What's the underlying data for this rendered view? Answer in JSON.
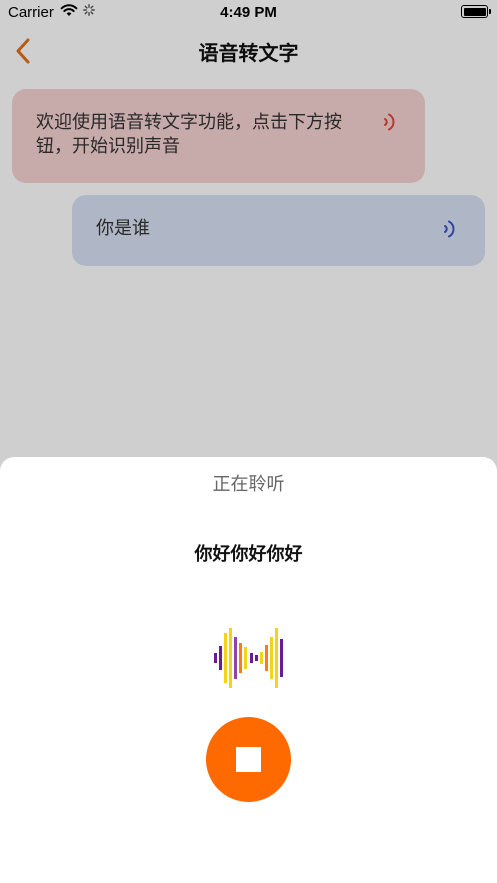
{
  "status_bar": {
    "carrier": "Carrier",
    "time": "4:49 PM"
  },
  "nav": {
    "title": "语音转文字",
    "back_icon": "chevron-left-icon"
  },
  "messages": [
    {
      "side": "received",
      "text": "欢迎使用语音转文字功能，点击下方按钮，开始识别声音",
      "voice_icon_color": "#e0473b"
    },
    {
      "side": "sent",
      "text": "你是谁",
      "voice_icon_color": "#3b55c8"
    }
  ],
  "sheet": {
    "status": "正在聆听",
    "transcript": "你好你好你好",
    "stop_button_color": "#ff6a00"
  },
  "colors": {
    "accent": "#ff6a00",
    "received_bubble": "#f6d3d2",
    "sent_bubble": "#d8e1f3"
  }
}
